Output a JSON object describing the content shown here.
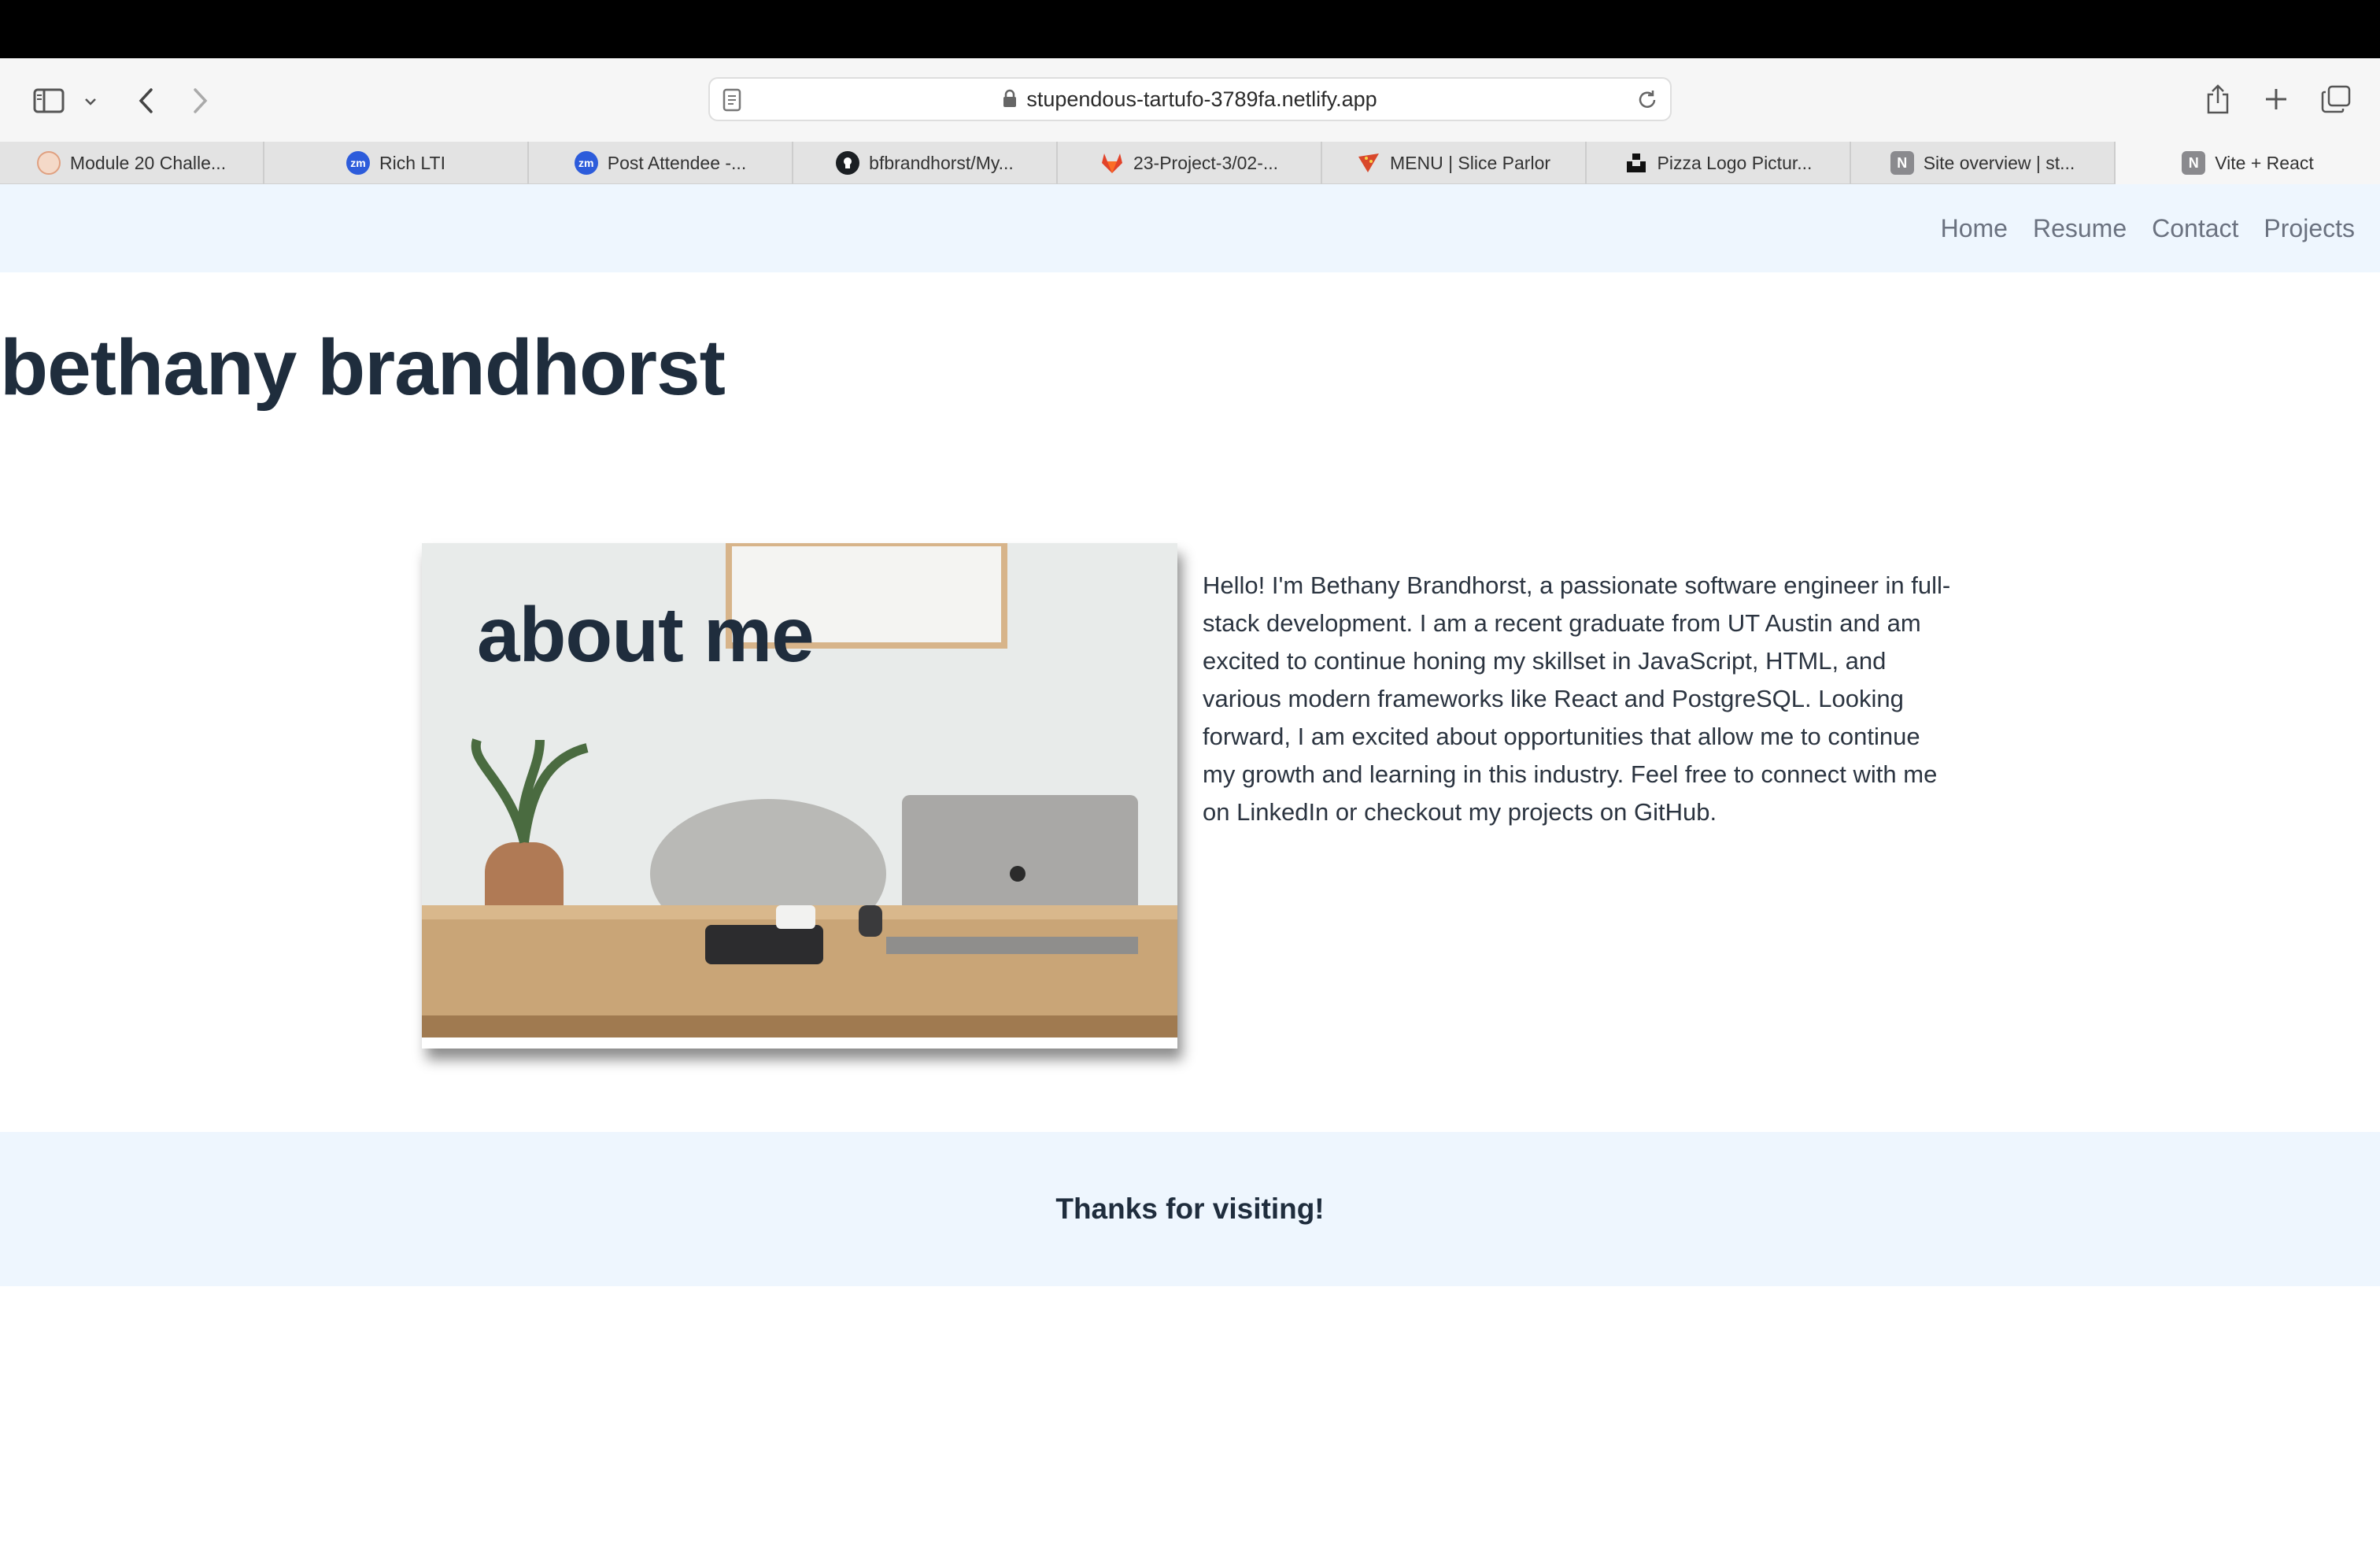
{
  "browser": {
    "url": "stupendous-tartufo-3789fa.netlify.app",
    "tabs": [
      {
        "title": "Module 20 Challe...",
        "icon": "module-favicon-icon"
      },
      {
        "title": "Rich LTI",
        "icon": "zoom-favicon-icon",
        "fav_text": "zm"
      },
      {
        "title": "Post Attendee -...",
        "icon": "zoom-favicon-icon",
        "fav_text": "zm"
      },
      {
        "title": "bfbrandhorst/My...",
        "icon": "github-icon"
      },
      {
        "title": "23-Project-3/02-...",
        "icon": "gitlab-icon"
      },
      {
        "title": "MENU | Slice Parlor",
        "icon": "slice-parlor-icon"
      },
      {
        "title": "Pizza Logo Pictur...",
        "icon": "unsplash-icon"
      },
      {
        "title": "Site overview | st...",
        "icon": "netlify-n-icon",
        "fav_text": "N"
      },
      {
        "title": "Vite + React",
        "icon": "netlify-n-icon",
        "fav_text": "N"
      }
    ]
  },
  "site": {
    "nav": [
      "Home",
      "Resume",
      "Contact",
      "Projects"
    ],
    "name": "bethany brandhorst",
    "about_heading": "about me",
    "bio": "Hello! I'm Bethany Brandhorst, a passionate software engineer in full-stack development. I am a recent graduate from UT Austin and am excited to continue honing my skillset in JavaScript, HTML, and various modern frameworks like React and PostgreSQL. Looking forward, I am excited about opportunities that allow me to continue my growth and learning in this industry. Feel free to connect with me on LinkedIn or checkout my projects on GitHub.",
    "footer": "Thanks for visiting!"
  },
  "colors": {
    "nav_bg": "#eef6fe",
    "heading": "#1f2d3d",
    "nav_link": "#6b7280"
  }
}
